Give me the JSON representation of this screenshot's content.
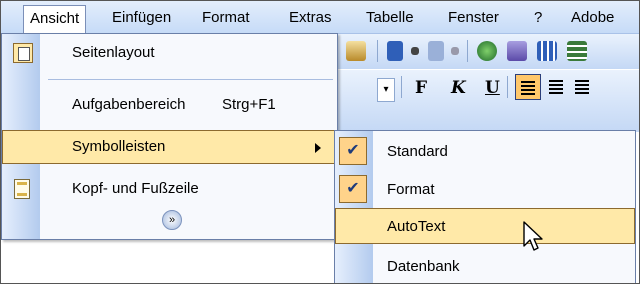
{
  "menubar": {
    "items": [
      {
        "label": "Ansicht"
      },
      {
        "label": "Einfügen"
      },
      {
        "label": "Format"
      },
      {
        "label": "Extras"
      },
      {
        "label": "Tabelle"
      },
      {
        "label": "Fenster"
      },
      {
        "label": "?"
      },
      {
        "label": "Adobe"
      }
    ]
  },
  "toolbar": {
    "bold": "F",
    "italic": "K",
    "underline": "U"
  },
  "menu": {
    "items": [
      {
        "label": "Seitenlayout",
        "icon": "page-layout-icon"
      },
      {
        "label": "Aufgabenbereich",
        "shortcut": "Strg+F1"
      },
      {
        "label": "Symbolleisten",
        "has_submenu": true
      },
      {
        "label": "Kopf- und Fußzeile",
        "icon": "header-footer-icon"
      }
    ],
    "expand_icon": "double-chevron-down-icon"
  },
  "submenu": {
    "items": [
      {
        "label": "Standard",
        "checked": true
      },
      {
        "label": "Format",
        "checked": true
      },
      {
        "label": "AutoText",
        "checked": false
      },
      {
        "label": "Datenbank",
        "checked": false
      }
    ]
  },
  "colors": {
    "highlight": "#ffe9a8",
    "highlight_border": "#8c6a2f",
    "menubar": "#c6dbf7"
  }
}
